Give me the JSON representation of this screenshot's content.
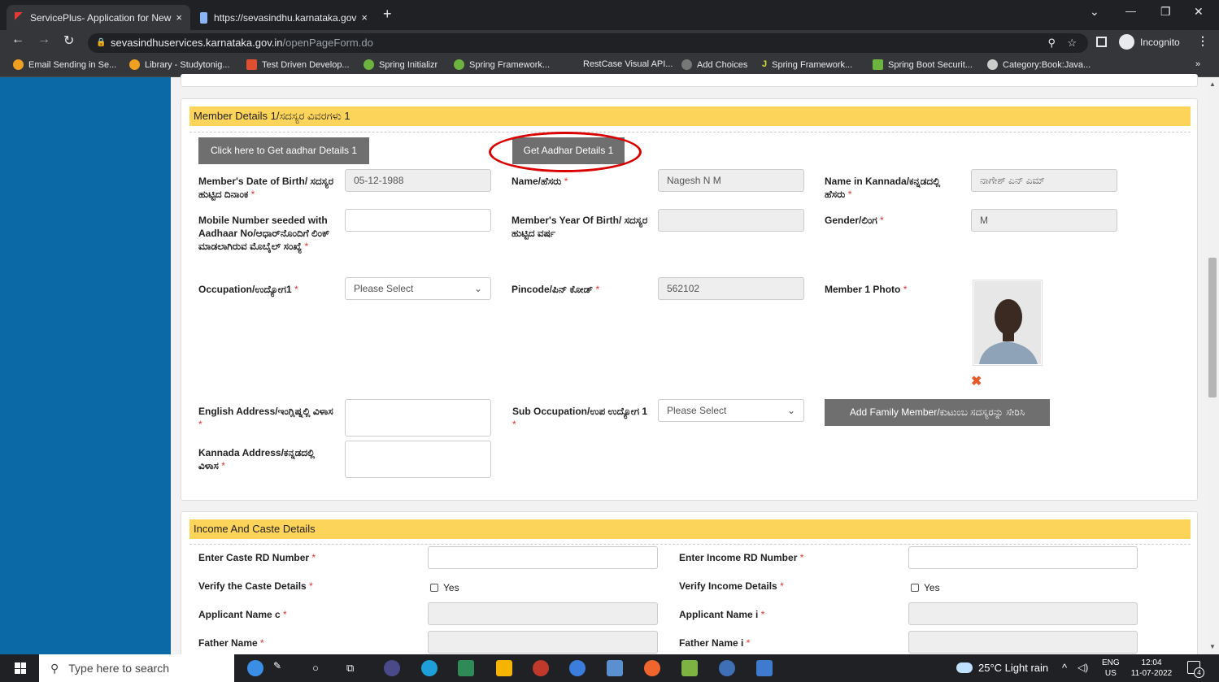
{
  "tabs": [
    {
      "label": "ServicePlus- Application for New",
      "close": "×"
    },
    {
      "label": "https://sevasindhu.karnataka.gov",
      "close": "×"
    }
  ],
  "new_tab": "+",
  "window_controls": {
    "dropdown": "⌄",
    "minimize": "—",
    "restore": "❐",
    "close": "✕"
  },
  "address": {
    "host": "sevasindhuservices.karnataka.gov.in",
    "path": "/openPageForm.do",
    "profile": "Incognito"
  },
  "bookmarks": [
    "Email Sending in Se...",
    "Library - Studytonig...",
    "Test Driven Develop...",
    "Spring Initializr",
    "Spring Framework...",
    "RestCase Visual API...",
    "Add Choices",
    "Spring Framework...",
    "Spring Boot Securit...",
    "Category:Book:Java..."
  ],
  "bookmarks_more": "»",
  "member": {
    "heading": "Member Details 1/ಸದಸ್ಯರ ವಿವರಗಳು 1",
    "btn_click_aadhar": "Click here to Get aadhar Details 1",
    "btn_get_aadhar": "Get Aadhar Details 1",
    "dob_label": "Member's Date of Birth/ ಸದಸ್ಯರ ಹುಟ್ಟಿದ ದಿನಾಂಕ",
    "dob_value": "05-12-1988",
    "name_label": "Name/ಹೆಸರು",
    "name_value": "Nagesh N M",
    "name_kn_label": "Name in Kannada/ಕನ್ನಡದಲ್ಲಿ ಹೆಸರು",
    "name_kn_value": "ನಾಗೇಶ್ ಎನ್ ಎಮ್",
    "mobile_label": "Mobile Number seeded with Aadhaar No/ಆಧಾರ್‌ನೊಂದಿಗೆ ಲಿಂಕ್ ಮಾಡಲಾಗಿರುವ ಮೊಬೈಲ್ ಸಂಖ್ಯೆ",
    "mobile_value": "",
    "yob_label": "Member's Year Of Birth/ ಸದಸ್ಯರ ಹುಟ್ಟಿದ ವರ್ಷ",
    "yob_value": "",
    "gender_label": "Gender/ಲಿಂಗ",
    "gender_value": "M",
    "occupation_label": "Occupation/ಉದ್ಯೋಗ1",
    "occupation_value": "Please Select",
    "pincode_label": "Pincode/ಪಿನ್ ಕೋಡ್",
    "pincode_value": "562102",
    "photo_label": "Member 1 Photo",
    "photo_remove": "✖",
    "eng_addr_label": "English Address/ಇಂಗ್ಲಿಷ್ನಲ್ಲಿ ವಿಳಾಸ",
    "sub_occ_label": "Sub Occupation/ಉಪ ಉದ್ಯೋಗ 1",
    "sub_occ_value": "Please Select",
    "btn_add_family": "Add Family Member/ಕುಟುಂಬ ಸದಸ್ಯರನ್ನು ಸೇರಿಸಿ",
    "kn_addr_label": "Kannada Address/ಕನ್ನಡದಲ್ಲಿ ವಿಳಾಸ",
    "required_mark": "*"
  },
  "income": {
    "heading": "Income And Caste Details",
    "caste_rd_label": "Enter Caste RD Number",
    "income_rd_label": "Enter Income RD Number",
    "verify_caste_label": "Verify the Caste Details",
    "verify_income_label": "Verify Income Details",
    "yes": "Yes",
    "app_name_c_label": "Applicant Name c",
    "app_name_i_label": "Applicant Name i",
    "father_label": "Father Name",
    "father_i_label": "Father Name i"
  },
  "taskbar": {
    "search": "Type here to search",
    "weather": "25°C  Light rain",
    "lang": "ENG",
    "region": "US",
    "time": "12:04",
    "date": "11-07-2022",
    "notif": "4"
  },
  "colors": {
    "sidebar": "#0b6aa5",
    "header": "#fdd45a",
    "button": "#6f6f6f",
    "annotation": "#d90000"
  }
}
